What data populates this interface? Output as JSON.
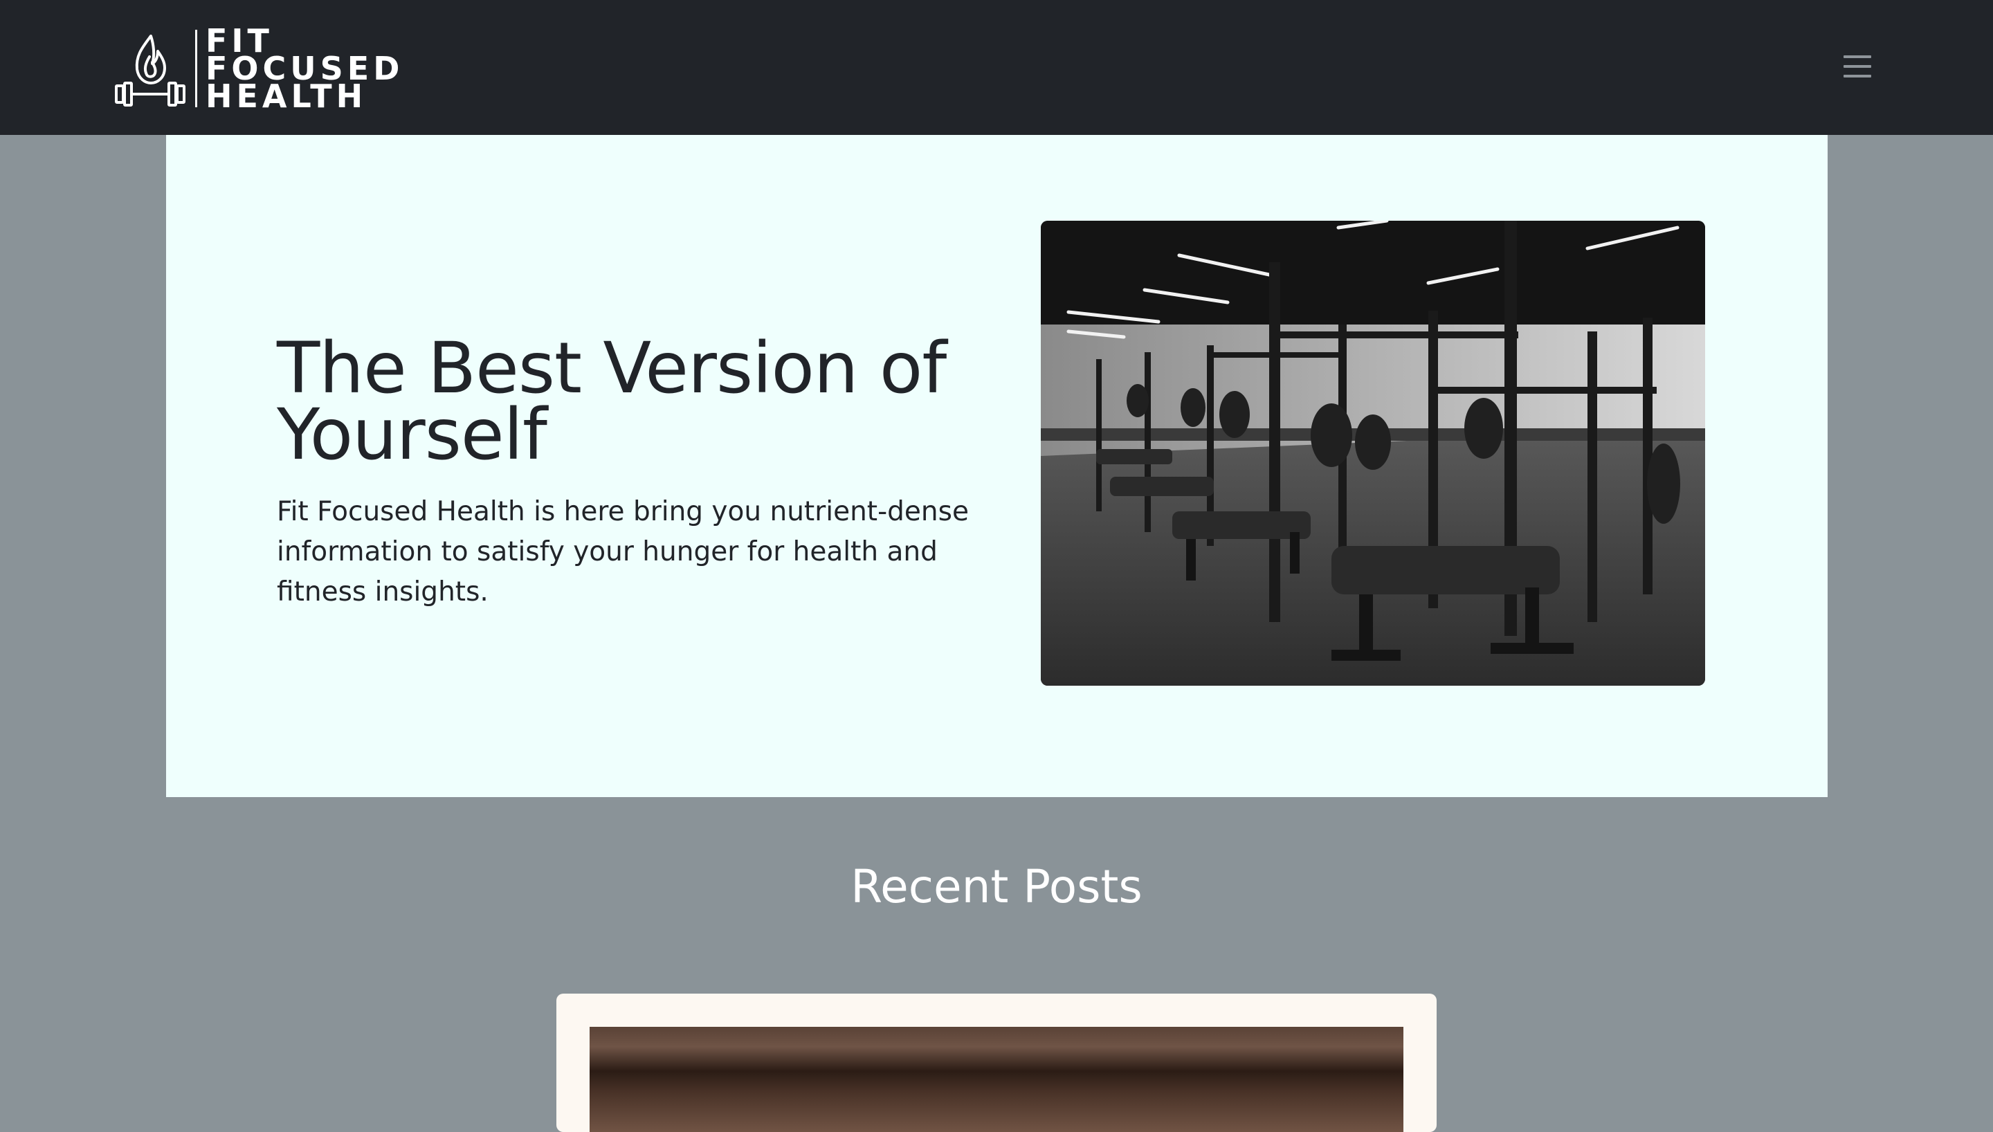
{
  "navbar": {
    "brand": {
      "line1": "FIT",
      "line2": "FOCUSED",
      "line3": "HEALTH",
      "logo_icon": "flame-barbell-icon"
    },
    "menu_icon": "hamburger-menu-icon"
  },
  "hero": {
    "title": "The Best Version of Yourself",
    "description": "Fit Focused Health is here bring you nutrient-dense information to satisfy your hunger for health and fitness insights.",
    "image_subject": "gym with power racks and benches"
  },
  "recent_posts": {
    "title": "Recent Posts"
  },
  "colors": {
    "navbar_bg": "#212429",
    "page_bg": "#8a9398",
    "hero_bg": "#effffd",
    "text_dark": "#212429",
    "card_bg": "#fdf8f2"
  }
}
